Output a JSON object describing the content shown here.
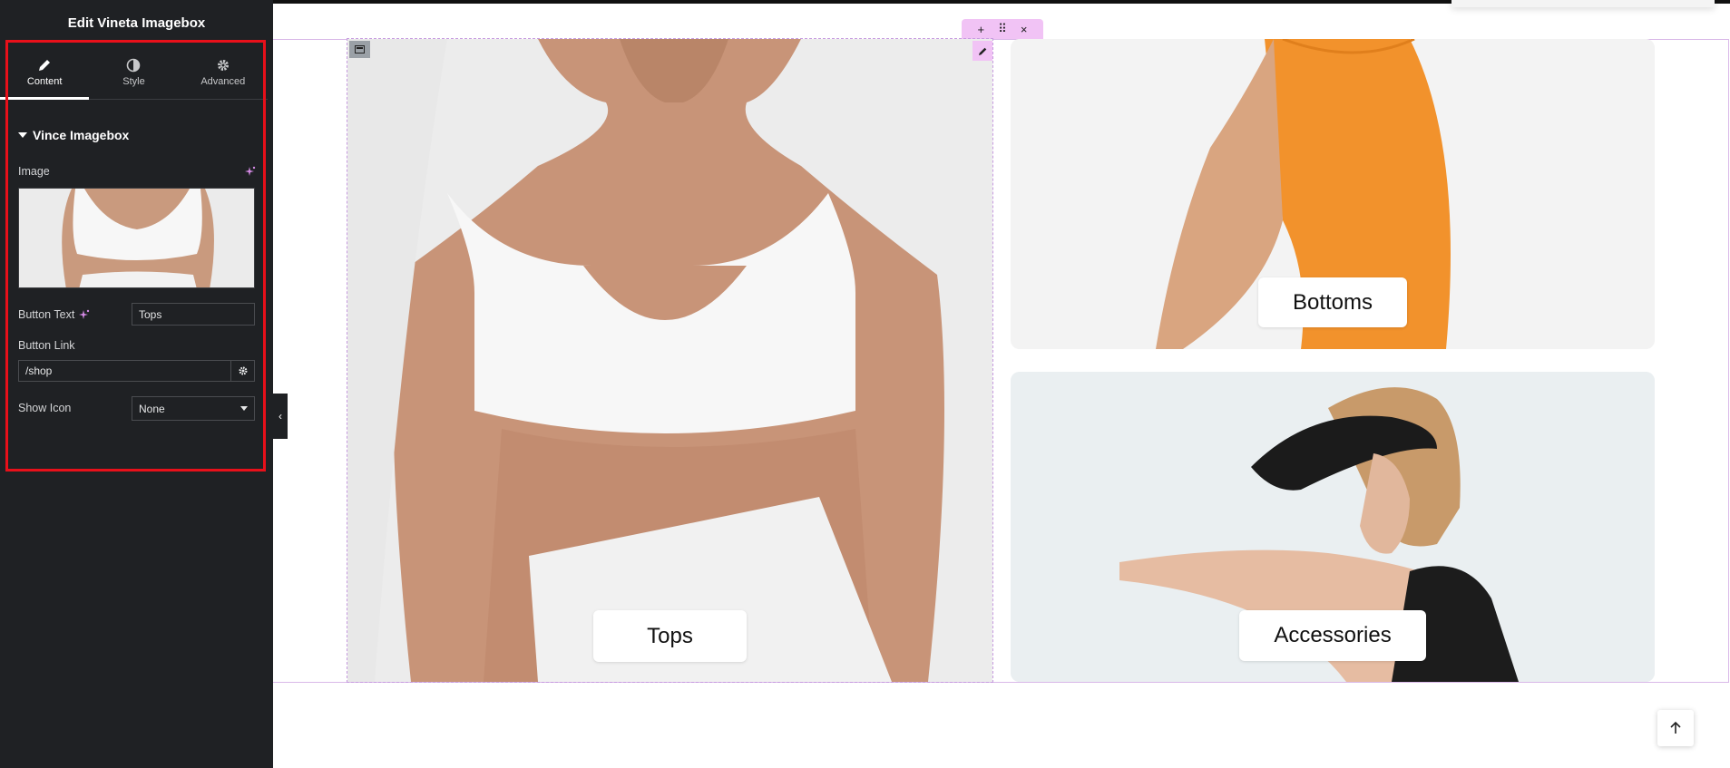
{
  "panel": {
    "title": "Edit Vineta Imagebox",
    "tabs": [
      {
        "label": "Content",
        "icon": "pencil-icon",
        "active": true
      },
      {
        "label": "Style",
        "icon": "half-circle-icon",
        "active": false
      },
      {
        "label": "Advanced",
        "icon": "gear-icon",
        "active": false
      }
    ],
    "section_title": "Vince Imagebox",
    "image_label": "Image",
    "button_text_label": "Button Text",
    "button_text_value": "Tops",
    "button_link_label": "Button Link",
    "button_link_value": "/shop",
    "show_icon_label": "Show Icon",
    "show_icon_value": "None"
  },
  "canvas": {
    "section_toolbar": {
      "add": "+",
      "move": "⠿",
      "close": "×"
    },
    "tiles": [
      {
        "label": "Tops"
      },
      {
        "label": "Bottoms"
      },
      {
        "label": "Accessories"
      }
    ]
  },
  "colors": {
    "panel_bg": "#1f2124",
    "highlight_border": "#e8101a",
    "editor_accent": "#f1c3f5",
    "shorts_orange": "#f2922c"
  }
}
